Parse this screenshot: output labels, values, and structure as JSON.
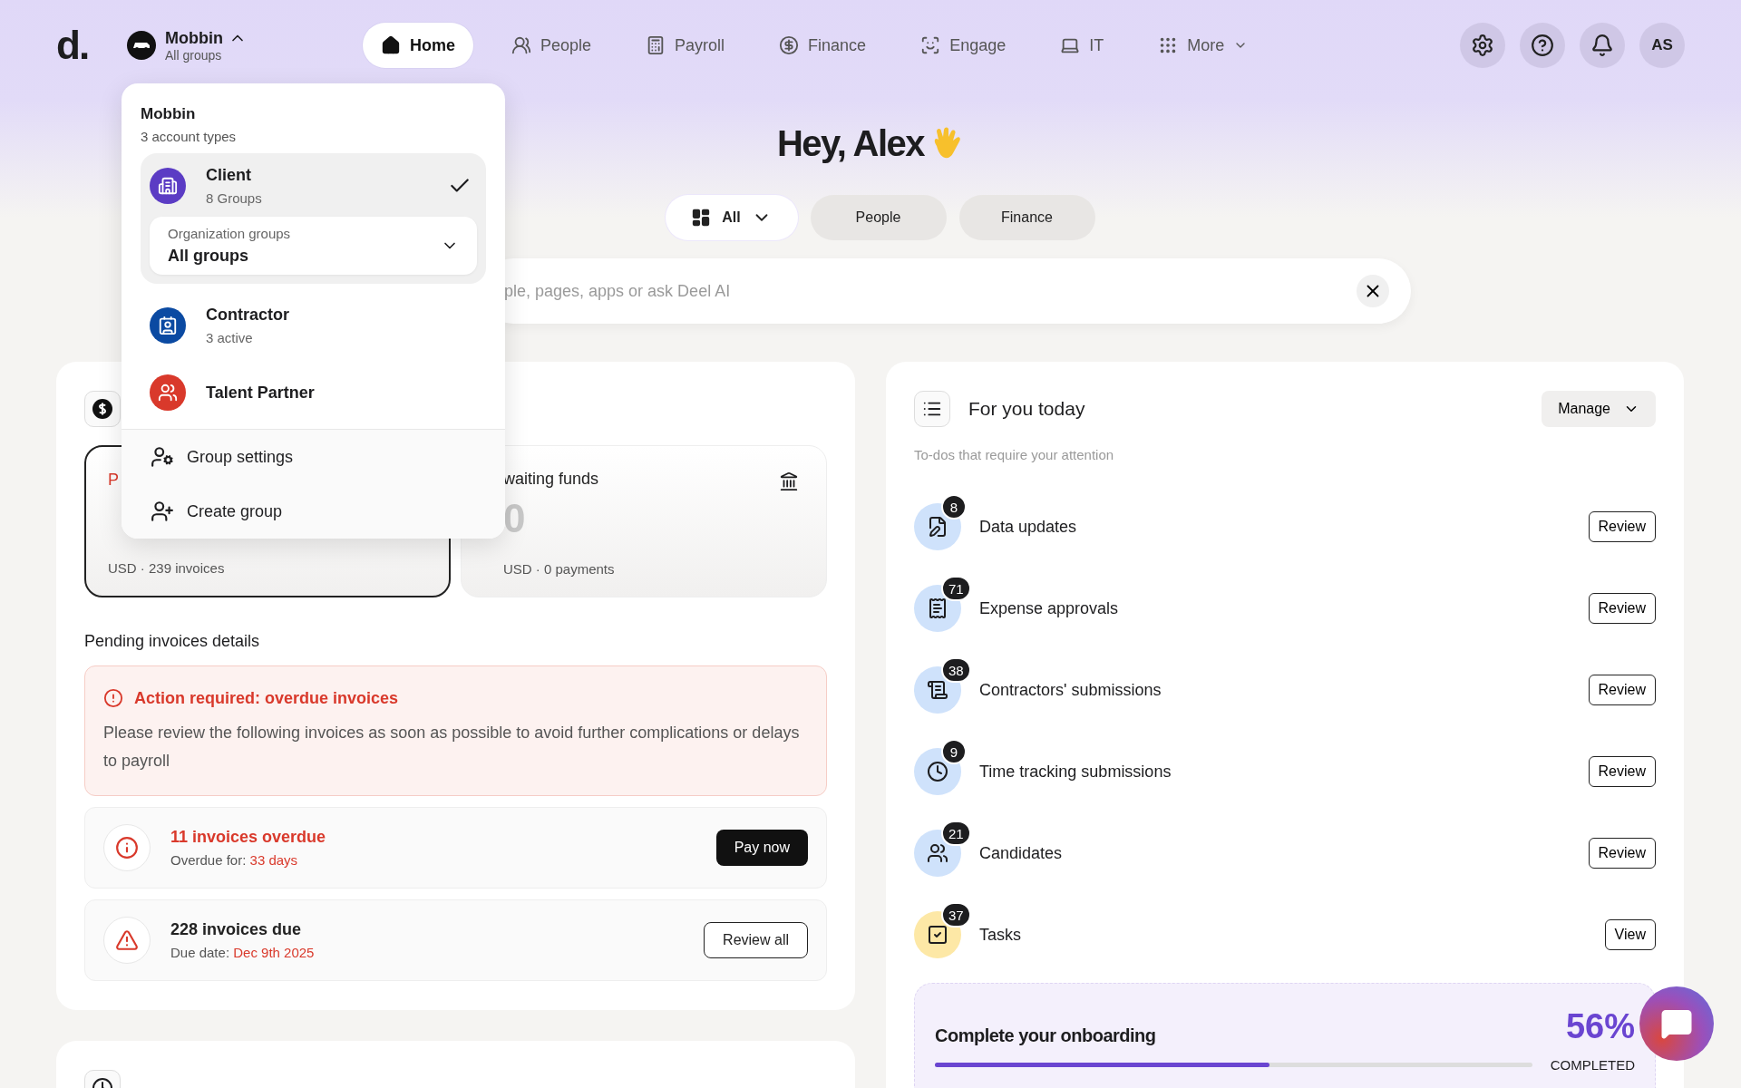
{
  "logo": "d.",
  "account": {
    "name": "Mobbin",
    "subtitle": "All groups",
    "expanded": true
  },
  "nav": [
    {
      "label": "Home",
      "selected": true
    },
    {
      "label": "People",
      "selected": false
    },
    {
      "label": "Payroll",
      "selected": false
    },
    {
      "label": "Finance",
      "selected": false
    },
    {
      "label": "Engage",
      "selected": false
    },
    {
      "label": "IT",
      "selected": false
    },
    {
      "label": "More",
      "selected": false
    }
  ],
  "avatar": "AS",
  "greeting": "Hey, Alex",
  "filters": [
    {
      "label": "All",
      "selected": true
    },
    {
      "label": "People",
      "selected": false
    },
    {
      "label": "Finance",
      "selected": false
    }
  ],
  "search": {
    "placeholder": "ple, pages, apps or ask Deel AI"
  },
  "account_menu": {
    "title": "Mobbin",
    "subtitle": "3 account types",
    "accounts": [
      {
        "name": "Client",
        "detail": "8 Groups",
        "selected": true,
        "color": "#5b3cc4",
        "groups": {
          "label": "Organization groups",
          "value": "All groups"
        }
      },
      {
        "name": "Contractor",
        "detail": "3 active",
        "selected": false,
        "color": "#0b4aa2"
      },
      {
        "name": "Talent Partner",
        "selected": false,
        "color": "#d9392b"
      }
    ],
    "actions": [
      "Group settings",
      "Create group"
    ]
  },
  "payments_card": {
    "tiles": [
      {
        "label": "P",
        "detail": "USD · 239 invoices",
        "selected": true
      },
      {
        "label": "waiting funds",
        "amount": "0",
        "detail": "USD · 0 payments",
        "selected": false
      }
    ],
    "section_title": "Pending invoices details",
    "alert": {
      "title": "Action required: overdue invoices",
      "text": "Please review the following invoices as soon as possible to avoid further complications or delays to payroll"
    },
    "invoices": [
      {
        "kind": "overdue",
        "title": "11 invoices overdue",
        "meta_label": "Overdue for:",
        "meta_value": "33 days",
        "action": "Pay now"
      },
      {
        "kind": "due",
        "title": "228 invoices due",
        "meta_label": "Due date:",
        "meta_value": "Dec 9th 2025",
        "action": "Review all"
      }
    ]
  },
  "todo_card": {
    "title": "For you today",
    "manage": "Manage",
    "subtitle": "To-dos that require your attention",
    "items": [
      {
        "label": "Data updates",
        "count": "8",
        "action": "Review",
        "color": "#cfe2fb"
      },
      {
        "label": "Expense approvals",
        "count": "71",
        "action": "Review",
        "color": "#cfe2fb"
      },
      {
        "label": "Contractors' submissions",
        "count": "38",
        "action": "Review",
        "color": "#cfe2fb"
      },
      {
        "label": "Time tracking submissions",
        "count": "9",
        "action": "Review",
        "color": "#cfe2fb"
      },
      {
        "label": "Candidates",
        "count": "21",
        "action": "Review",
        "color": "#cfe2fb"
      },
      {
        "label": "Tasks",
        "count": "37",
        "action": "View",
        "color": "#fde8a6"
      }
    ],
    "onboarding": {
      "title": "Complete your onboarding",
      "percent": "56%",
      "status": "COMPLETED",
      "level": 0.56
    }
  }
}
